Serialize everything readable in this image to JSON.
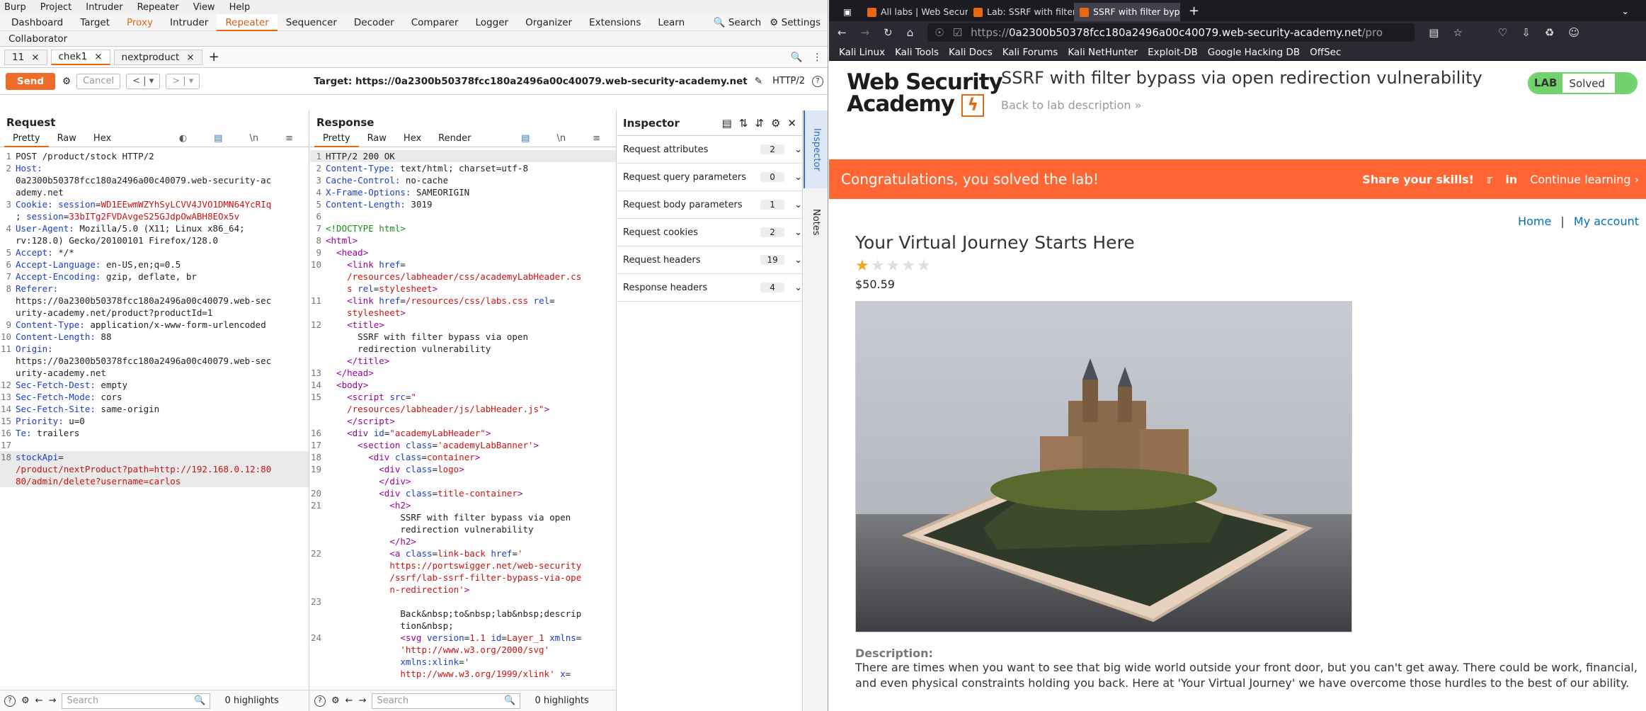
{
  "burp": {
    "menu": [
      "Burp",
      "Project",
      "Intruder",
      "Repeater",
      "View",
      "Help"
    ],
    "tools": [
      "Dashboard",
      "Target",
      "Proxy",
      "Intruder",
      "Repeater",
      "Sequencer",
      "Decoder",
      "Comparer",
      "Logger",
      "Organizer",
      "Extensions",
      "Learn"
    ],
    "search_label": "Search",
    "settings_label": "Settings",
    "collaborator": "Collaborator",
    "repeater_tabs": [
      "11",
      "chek1",
      "nextproduct"
    ],
    "send_label": "Send",
    "cancel_label": "Cancel",
    "target_label": "Target: https://0a2300b50378fcc180a2496a00c40079.web-security-academy.net",
    "http_version": "HTTP/2",
    "request": {
      "title": "Request",
      "tabs": [
        "Pretty",
        "Raw",
        "Hex"
      ]
    },
    "response": {
      "title": "Response",
      "tabs": [
        "Pretty",
        "Raw",
        "Hex",
        "Render"
      ]
    },
    "search_placeholder": "Search",
    "highlights": "0 highlights",
    "inspector": {
      "title": "Inspector",
      "rows": [
        {
          "label": "Request attributes",
          "count": "2"
        },
        {
          "label": "Request query parameters",
          "count": "0"
        },
        {
          "label": "Request body parameters",
          "count": "1"
        },
        {
          "label": "Request cookies",
          "count": "2"
        },
        {
          "label": "Request headers",
          "count": "19"
        },
        {
          "label": "Response headers",
          "count": "4"
        }
      ]
    },
    "side_tabs": [
      "Inspector",
      "Notes"
    ]
  },
  "firefox": {
    "tabs": [
      "All labs | Web Security Ac",
      "Lab: SSRF with filter bypa",
      "SSRF with filter bypass vi"
    ],
    "url_prefix": "https://",
    "url_domain": "0a2300b50378fcc180a2496a00c40079.web-security-academy.net",
    "url_suffix": "/pro",
    "bookmarks": [
      "Kali Linux",
      "Kali Tools",
      "Kali Docs",
      "Kali Forums",
      "Kali NetHunter",
      "Exploit-DB",
      "Google Hacking DB",
      "OffSec"
    ]
  },
  "page": {
    "logo_line1": "Web Security",
    "logo_line2": "Academy",
    "lab_title": "SSRF with filter bypass via open redirection vulnerability",
    "back_link": "Back to lab description",
    "badge_lab": "LAB",
    "badge_status": "Solved",
    "banner_text": "Congratulations, you solved the lab!",
    "share": "Share your skills!",
    "continue": "Continue learning",
    "home": "Home",
    "sep": "|",
    "account": "My account",
    "product_title": "Your Virtual Journey Starts Here",
    "rating": 1,
    "price": "$50.59",
    "desc_label": "Description:",
    "description": "There are times when you want to see that big wide world outside your front door, but you can't get away. There could be work, financial, and even physical constraints holding you back. Here at 'Your Virtual Journey' we have overcome those hurdles to the best of our ability."
  },
  "accent": "#e8670f",
  "banner_color": "#ff6633",
  "solved_color": "#70d16d"
}
